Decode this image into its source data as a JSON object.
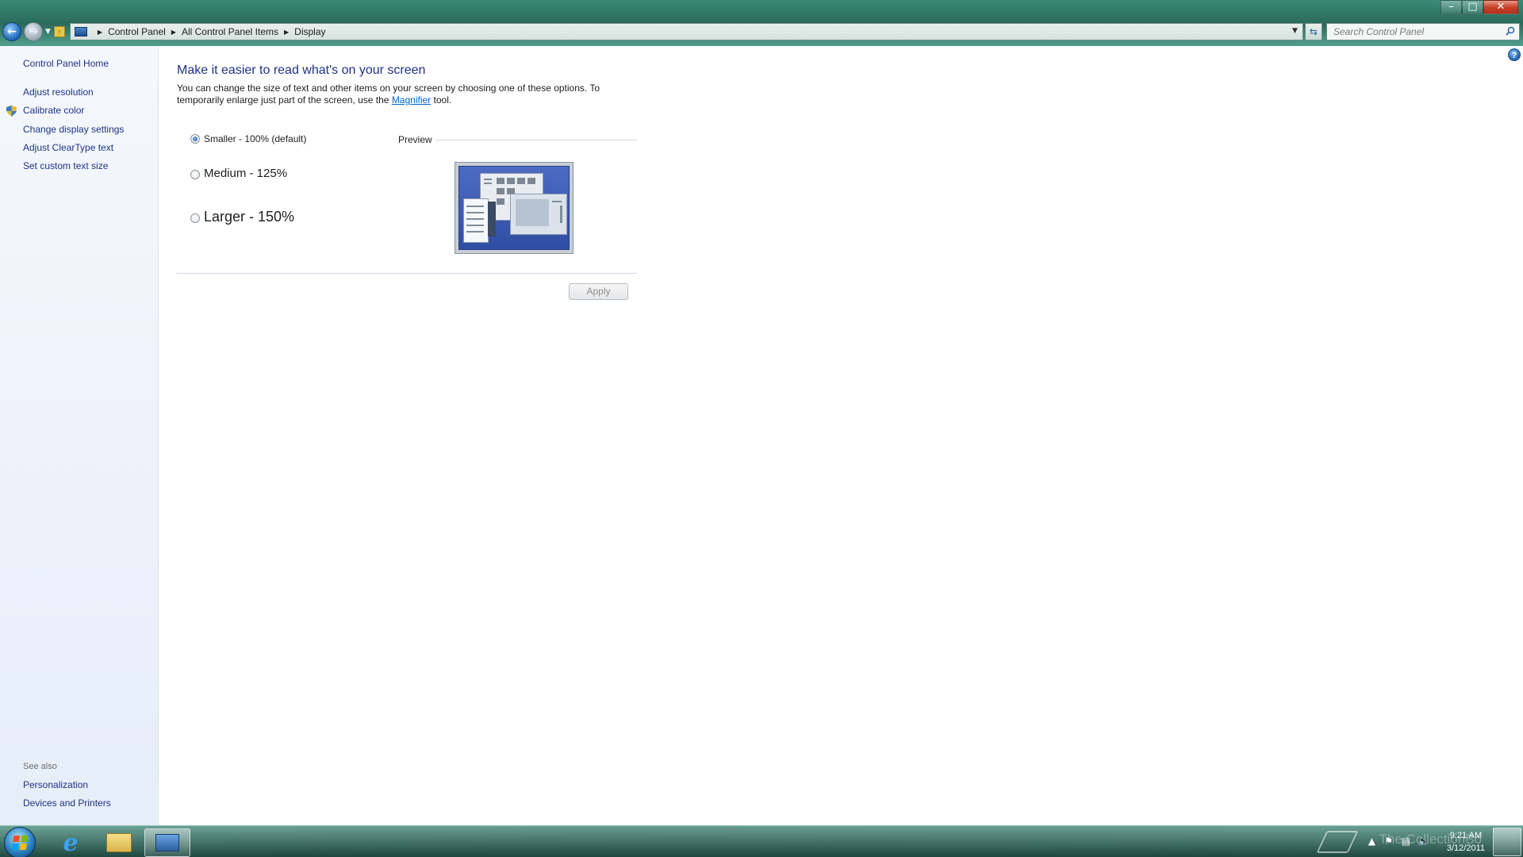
{
  "window": {
    "caption_minimize": "–",
    "caption_maximize": "□",
    "caption_close": "✕"
  },
  "address": {
    "crumbs": [
      "Control Panel",
      "All Control Panel Items",
      "Display"
    ],
    "search_placeholder": "Search Control Panel"
  },
  "sidebar": {
    "home": "Control Panel Home",
    "items": [
      "Adjust resolution",
      "Calibrate color",
      "Change display settings",
      "Adjust ClearType text",
      "Set custom text size"
    ],
    "see_also_label": "See also",
    "see_also": [
      "Personalization",
      "Devices and Printers"
    ]
  },
  "main": {
    "title": "Make it easier to read what's on your screen",
    "desc_part1": "You can change the size of text and other items on your screen by choosing one of these options. To temporarily enlarge just part of the screen, use the ",
    "desc_link": "Magnifier",
    "desc_part2": " tool.",
    "options": [
      {
        "label": "Smaller - 100% (default)",
        "checked": true
      },
      {
        "label": "Medium - 125%",
        "checked": false
      },
      {
        "label": "Larger - 150%",
        "checked": false
      }
    ],
    "preview_label": "Preview",
    "apply_label": "Apply",
    "help": "?"
  },
  "taskbar": {
    "watermark": "The CollectionBo",
    "time": "9:21 AM",
    "date": "3/12/2011"
  },
  "colors": {
    "link": "#1e3287",
    "accent_blue": "#0066cc"
  }
}
